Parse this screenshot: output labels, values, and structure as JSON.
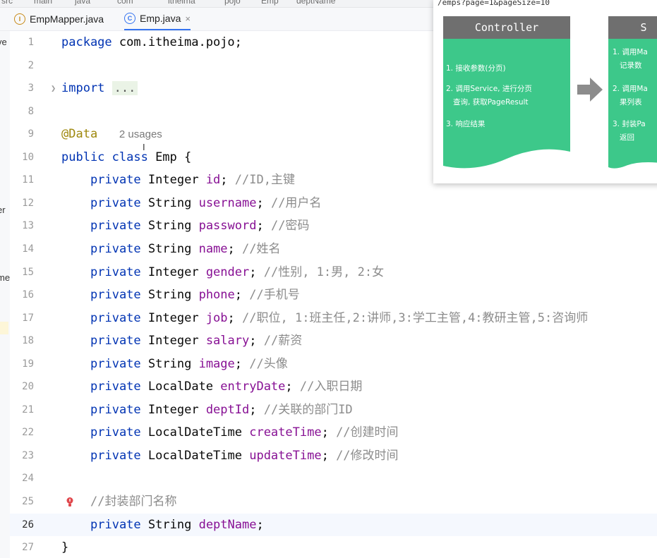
{
  "breadcrumb": [
    "src",
    "main",
    "java",
    "com",
    "itheima",
    "pojo",
    "Emp",
    "deptName"
  ],
  "tabs": [
    {
      "label": "EmpMapper.java",
      "icon": "interface-icon",
      "active": false
    },
    {
      "label": "Emp.java",
      "icon": "class-icon",
      "active": true,
      "close": "×"
    }
  ],
  "left_panel_fragments": [
    "ve",
    "er",
    "me"
  ],
  "editor": {
    "lines": [
      {
        "num": "1",
        "text": "package com.itheima.pojo;"
      },
      {
        "num": "2",
        "text": ""
      },
      {
        "num": "3",
        "text": "import ..."
      },
      {
        "num": "8",
        "text": ""
      },
      {
        "num": "9",
        "text": "@Data",
        "hint": "2 usages"
      },
      {
        "num": "10",
        "text": "public class Emp {"
      },
      {
        "num": "11",
        "type": "Integer",
        "name": "id",
        "comment": "//ID,主键"
      },
      {
        "num": "12",
        "type": "String",
        "name": "username",
        "comment": "//用户名"
      },
      {
        "num": "13",
        "type": "String",
        "name": "password",
        "comment": "//密码"
      },
      {
        "num": "14",
        "type": "String",
        "name": "name",
        "comment": "//姓名"
      },
      {
        "num": "15",
        "type": "Integer",
        "name": "gender",
        "comment": "//性别, 1:男, 2:女"
      },
      {
        "num": "16",
        "type": "String",
        "name": "phone",
        "comment": "//手机号"
      },
      {
        "num": "17",
        "type": "Integer",
        "name": "job",
        "comment": "//职位, 1:班主任,2:讲师,3:学工主管,4:教研主管,5:咨询师"
      },
      {
        "num": "18",
        "type": "Integer",
        "name": "salary",
        "comment": "//薪资"
      },
      {
        "num": "19",
        "type": "String",
        "name": "image",
        "comment": "//头像"
      },
      {
        "num": "20",
        "type": "LocalDate",
        "name": "entryDate",
        "comment": "//入职日期"
      },
      {
        "num": "21",
        "type": "Integer",
        "name": "deptId",
        "comment": "//关联的部门ID"
      },
      {
        "num": "22",
        "type": "LocalDateTime",
        "name": "createTime",
        "comment": "//创建时间"
      },
      {
        "num": "23",
        "type": "LocalDateTime",
        "name": "updateTime",
        "comment": "//修改时间"
      },
      {
        "num": "24",
        "text": ""
      },
      {
        "num": "25",
        "comment": "//封装部门名称"
      },
      {
        "num": "26",
        "type": "String",
        "name": "deptName",
        "comment": ""
      },
      {
        "num": "27",
        "text": "}"
      }
    ],
    "keyword_private": "private",
    "current_line": "26"
  },
  "diagram": {
    "url": "/emps?page=1&pageSize=10",
    "controller": {
      "title": "Controller",
      "items": [
        "1. 接收参数(分页)",
        "2. 调用Service, 进行分页\n   查询, 获取PageResult",
        "3. 响应结果"
      ]
    },
    "service": {
      "title": "S",
      "items": [
        "1. 调用Ma\n   记录数",
        "2. 调用Ma\n   果列表",
        "3. 封装Pa\n   返回"
      ]
    },
    "colors": {
      "header": "#6f6f6f",
      "body": "#3dc88a",
      "arrow": "#8c8c8c"
    }
  }
}
